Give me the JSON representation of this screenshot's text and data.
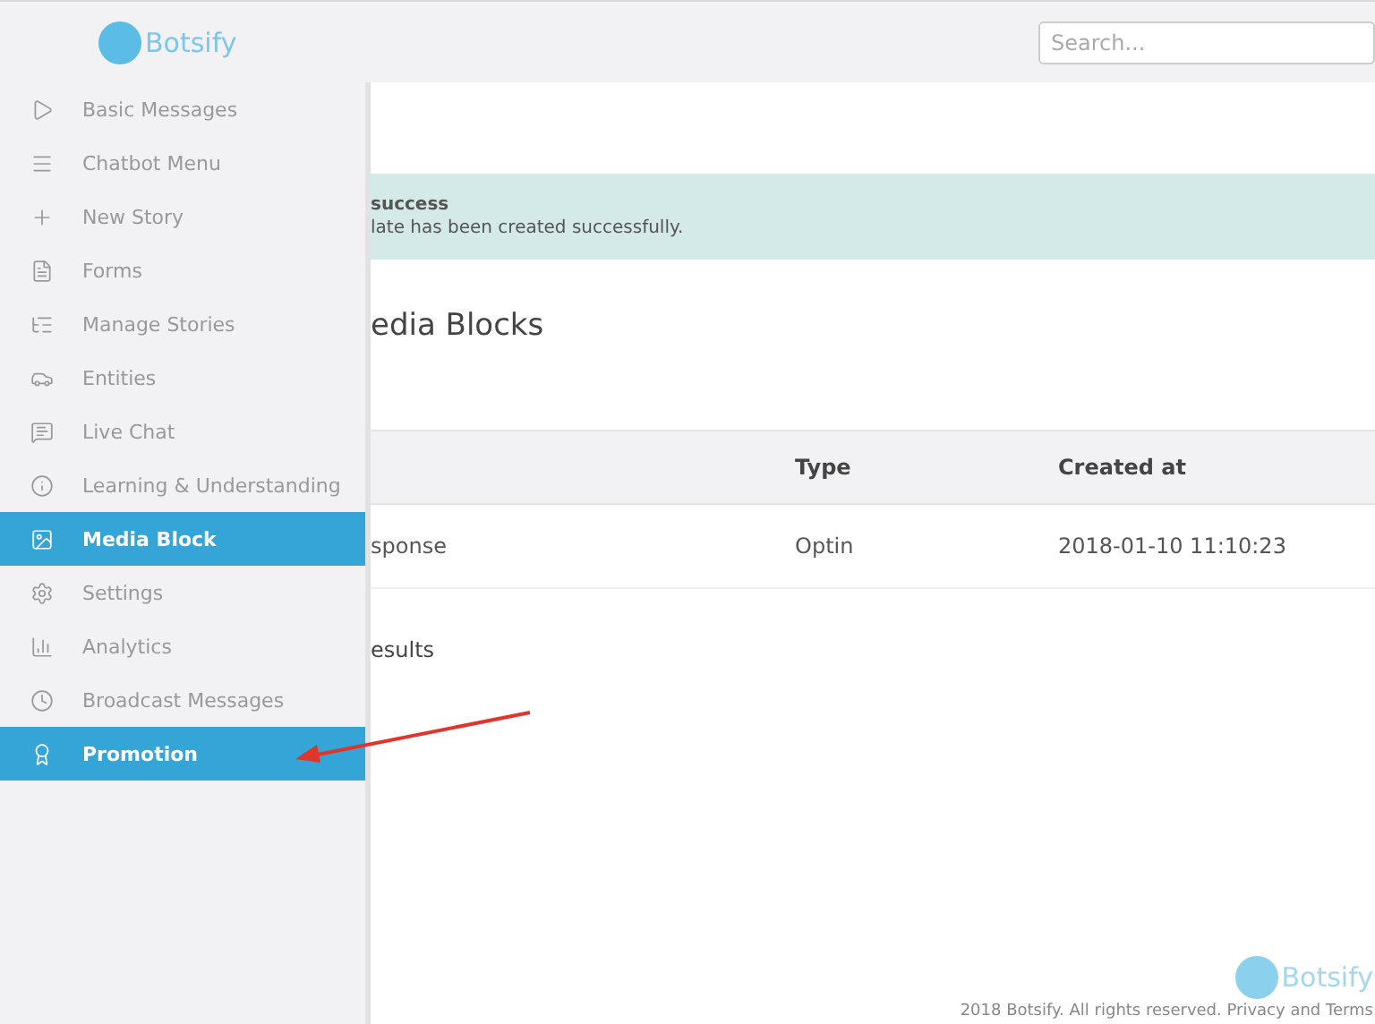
{
  "header": {
    "logo_text": "Botsify",
    "search": {
      "placeholder": "Search..."
    }
  },
  "sidebar": {
    "items": [
      {
        "label": "Basic Messages",
        "selected": false
      },
      {
        "label": "Chatbot Menu",
        "selected": false
      },
      {
        "label": "New Story",
        "selected": false
      },
      {
        "label": "Forms",
        "selected": false
      },
      {
        "label": "Manage Stories",
        "selected": false
      },
      {
        "label": "Entities",
        "selected": false
      },
      {
        "label": "Live Chat",
        "selected": false
      },
      {
        "label": "Learning & Understanding",
        "selected": false
      },
      {
        "label": "Media Block",
        "selected": true
      },
      {
        "label": "Settings",
        "selected": false
      },
      {
        "label": "Analytics",
        "selected": false
      },
      {
        "label": "Broadcast Messages",
        "selected": false
      },
      {
        "label": "Promotion",
        "selected": true
      }
    ]
  },
  "alert": {
    "title": "success",
    "message": "late has been created successfully."
  },
  "page_title": "edia Blocks",
  "table": {
    "columns": [
      "",
      "Type",
      "Created at"
    ],
    "rows": [
      [
        "sponse",
        "Optin",
        "2018-01-10 11:10:23"
      ]
    ]
  },
  "results_text": "esults",
  "footer": {
    "logo_text": "Botsify",
    "copyright": "2018 Botsify. All rights reserved. Privacy and Terms"
  }
}
